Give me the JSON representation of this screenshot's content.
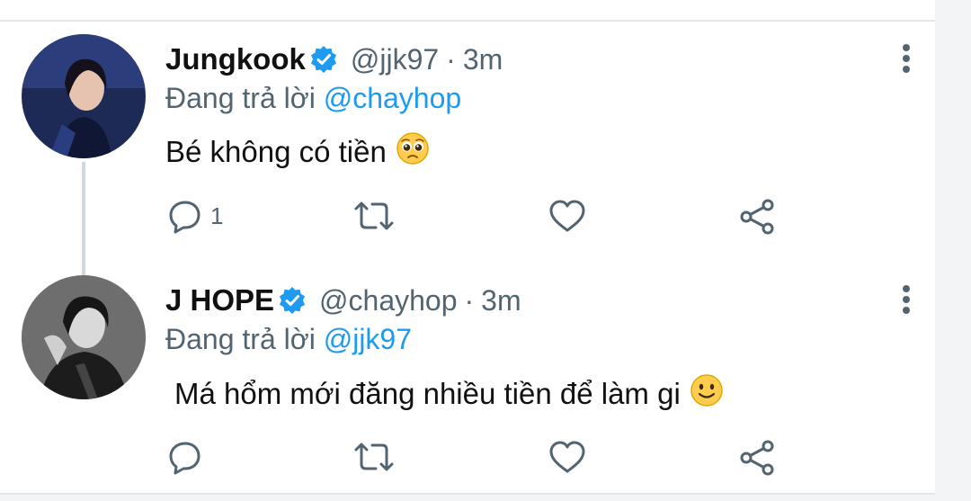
{
  "tweets": [
    {
      "name": "Jungkook",
      "handle": "@jjk97",
      "separator": "·",
      "time": "3m",
      "replying_prefix": "Đang trả lời",
      "replying_to": "@chayhop",
      "text": "Bé không có tiền",
      "emoji": "pleading-face",
      "reply_count": "1"
    },
    {
      "name": "J HOPE",
      "handle": "@chayhop",
      "separator": "·",
      "time": "3m",
      "replying_prefix": "Đang trả lời",
      "replying_to": "@jjk97",
      "text": "Má hổm mới đăng nhiều tiền để làm gi",
      "emoji": "slightly-smiling-face",
      "reply_count": ""
    }
  ],
  "colors": {
    "accent": "#1d9bf0",
    "secondary_text": "#536471",
    "primary_text": "#111111"
  }
}
